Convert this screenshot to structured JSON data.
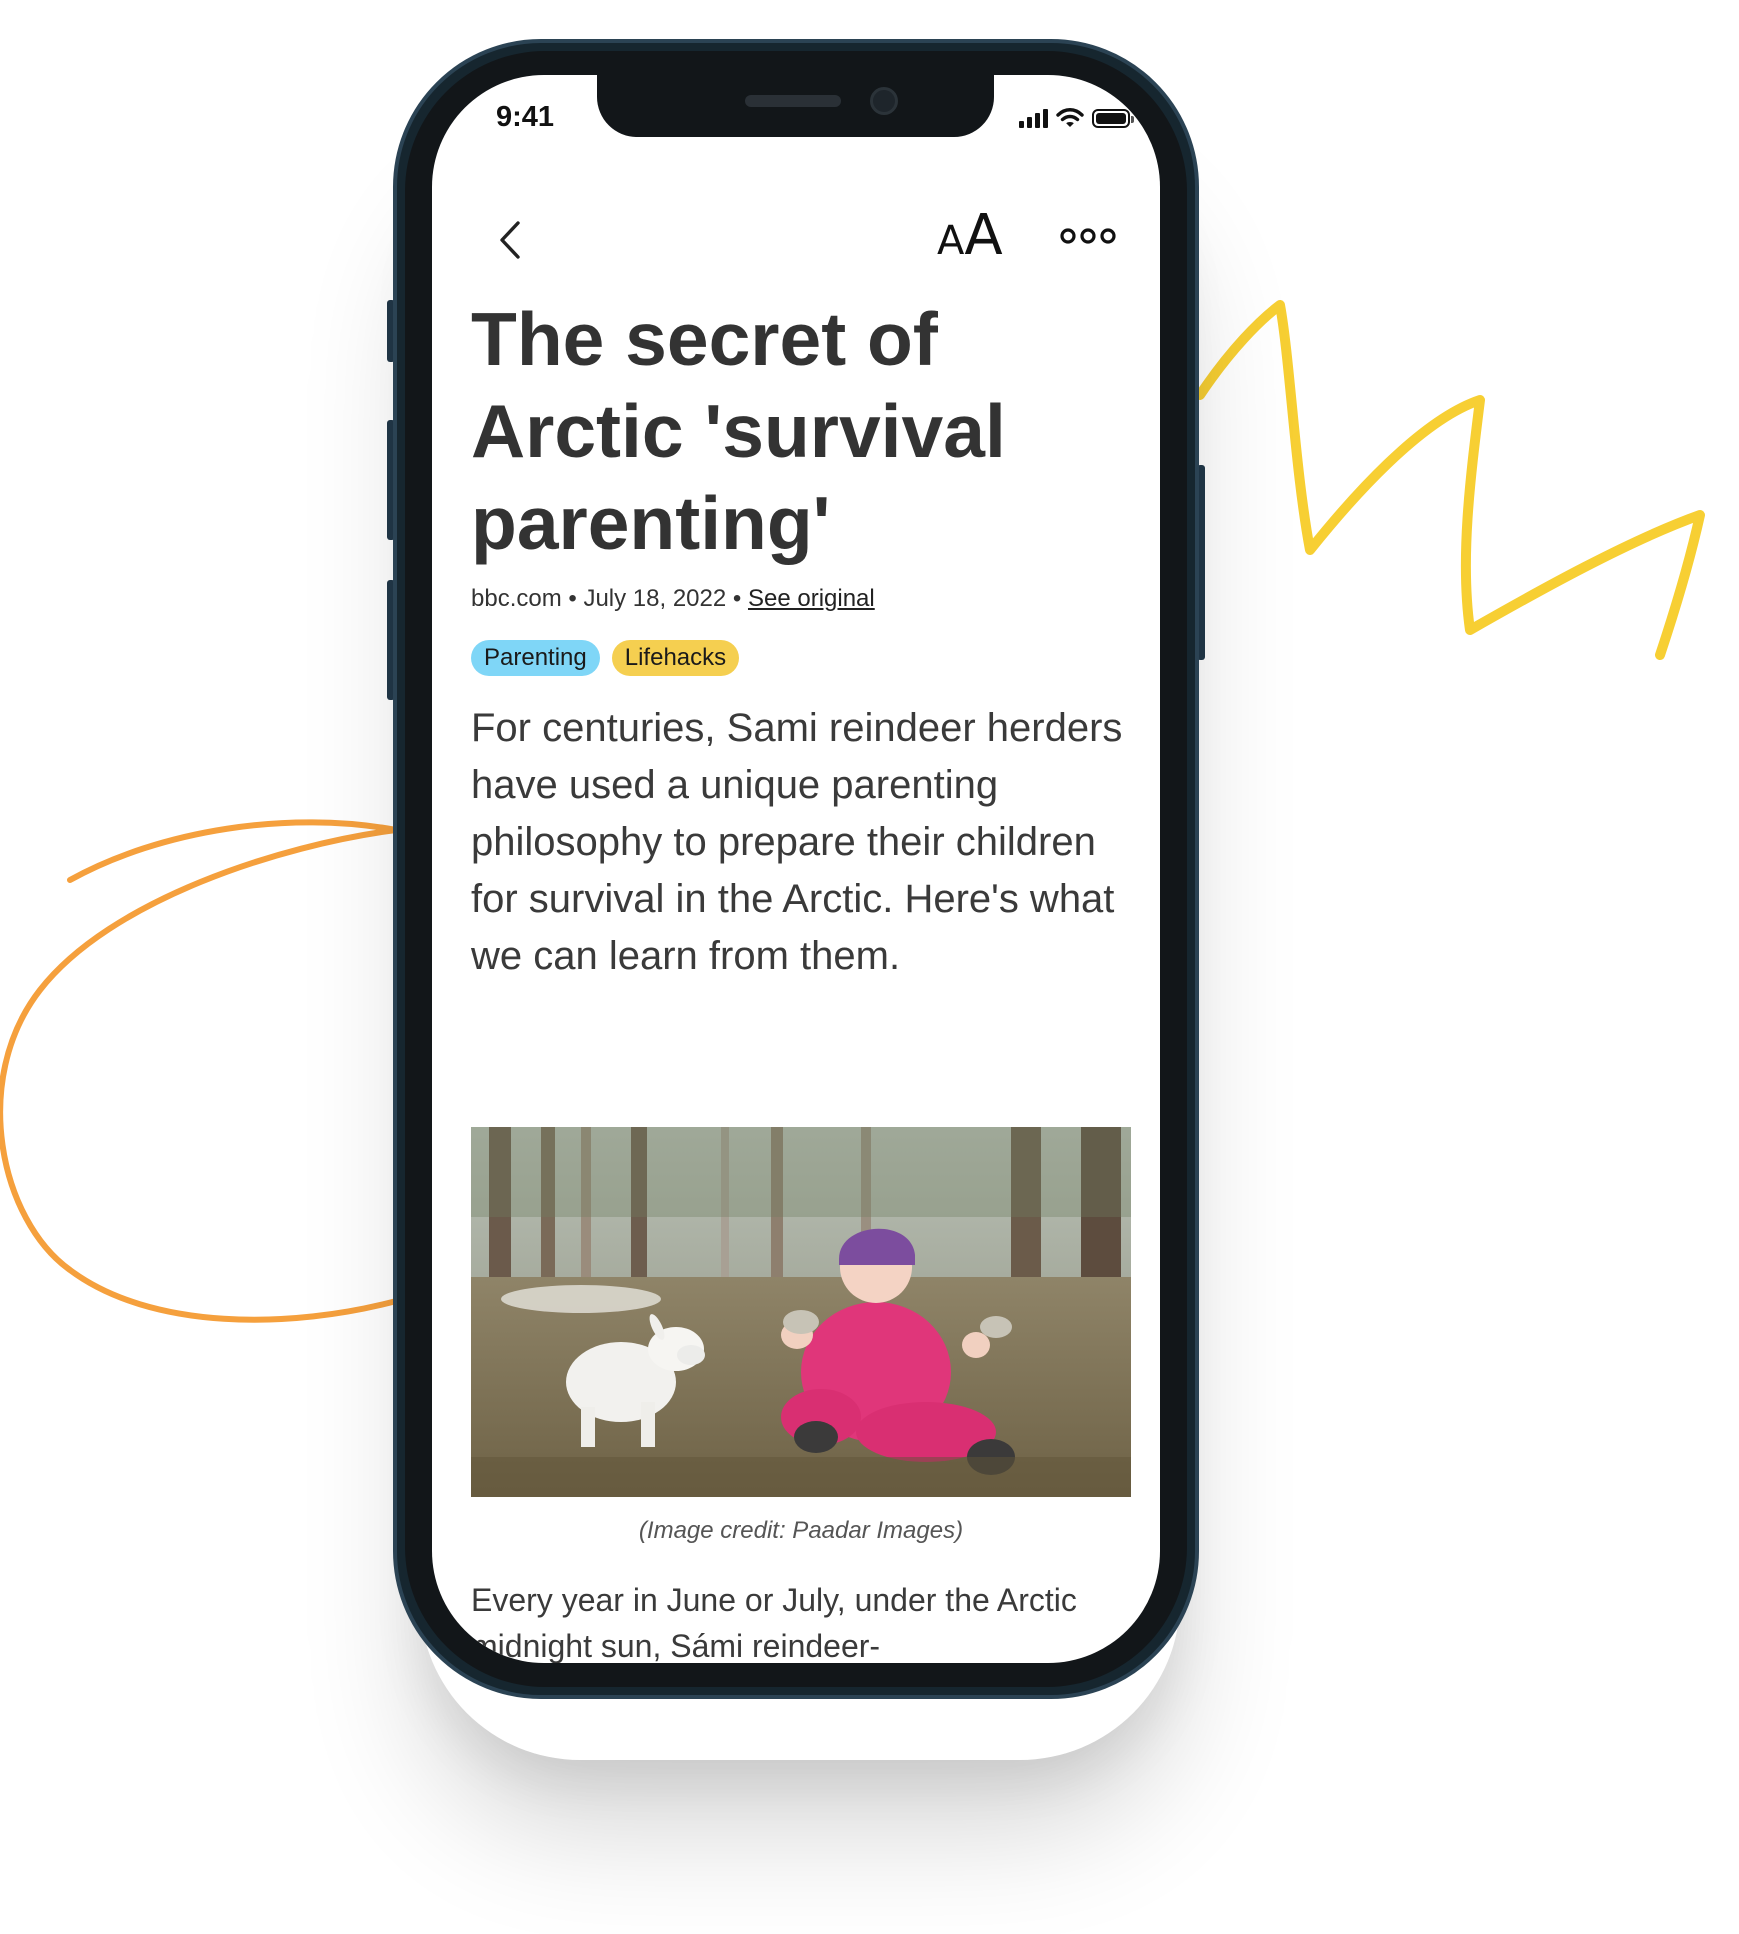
{
  "status_bar": {
    "time": "9:41"
  },
  "toolbar": {
    "back_icon": "chevron-left-icon",
    "text_size_small": "A",
    "text_size_large": "A",
    "more_icon": "ellipsis-icon"
  },
  "article": {
    "title": "The secret of Arctic 'survival parenting'",
    "source": "bbc.com",
    "separator": "•",
    "date": "July 18, 2022",
    "see_original": "See original",
    "tags": [
      {
        "label": "Parenting",
        "color": "#7fd6f7"
      },
      {
        "label": "Lifehacks",
        "color": "#f5cf50"
      }
    ],
    "summary": "For centuries, Sami reindeer herders have used a unique parenting philosophy to prepare their children for survival in the Arctic. Here's what we can learn from them.",
    "image_caption": "(Image credit: Paadar Images)",
    "body_start": "Every year in June or July, under the Arctic midnight sun, Sámi reindeer-"
  },
  "colors": {
    "phone_frame": "#16262f",
    "scribble_yellow": "#f7cf33",
    "scribble_orange": "#f5a03d",
    "title_text": "#333333"
  }
}
